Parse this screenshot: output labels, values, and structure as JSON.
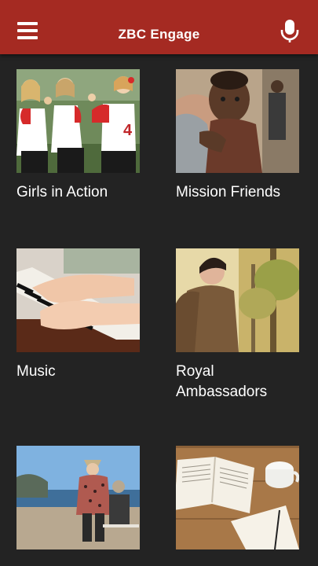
{
  "header": {
    "title": "ZBC Engage",
    "menu_icon": "hamburger-menu-icon",
    "mic_icon": "microphone-icon"
  },
  "colors": {
    "appbar": "#a52a22",
    "background": "#232323",
    "text": "#ffffff"
  },
  "tiles": [
    {
      "label": "Girls in Action",
      "image": "girls-softball-team-photo"
    },
    {
      "label": "Mission Friends",
      "image": "child-hugging-adult-photo"
    },
    {
      "label": "Music",
      "image": "hands-on-piano-photo"
    },
    {
      "label": "Royal\nAmbassadors",
      "image": "young-man-forest-photo"
    },
    {
      "label": "",
      "image": "women-at-beach-photo"
    },
    {
      "label": "",
      "image": "open-bible-coffee-photo"
    }
  ]
}
